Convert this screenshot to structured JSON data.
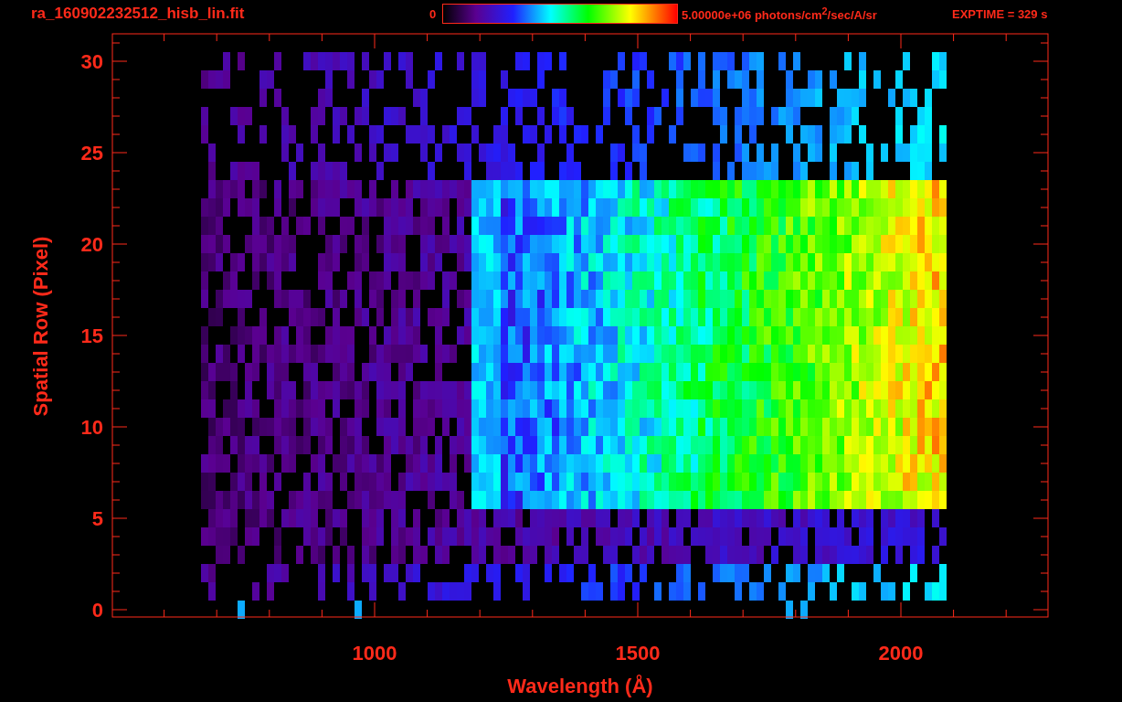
{
  "header": {
    "title": "ra_160902232512_hisb_lin.fit",
    "colorbar_min": "0",
    "colorbar_max": "5.00000e+06 photons/cm$^{2}$/sec/A/sr",
    "exptime": "EXPTIME = 329 s"
  },
  "plot": {
    "x_axis": {
      "title": "Wavelength (Å)",
      "ticks": [
        "1000",
        "1500",
        "2000"
      ]
    },
    "y_axis": {
      "title": "Spatial Row (Pixel)",
      "ticks": [
        "30",
        "25",
        "20",
        "15",
        "10",
        "5",
        "0"
      ]
    }
  }
}
